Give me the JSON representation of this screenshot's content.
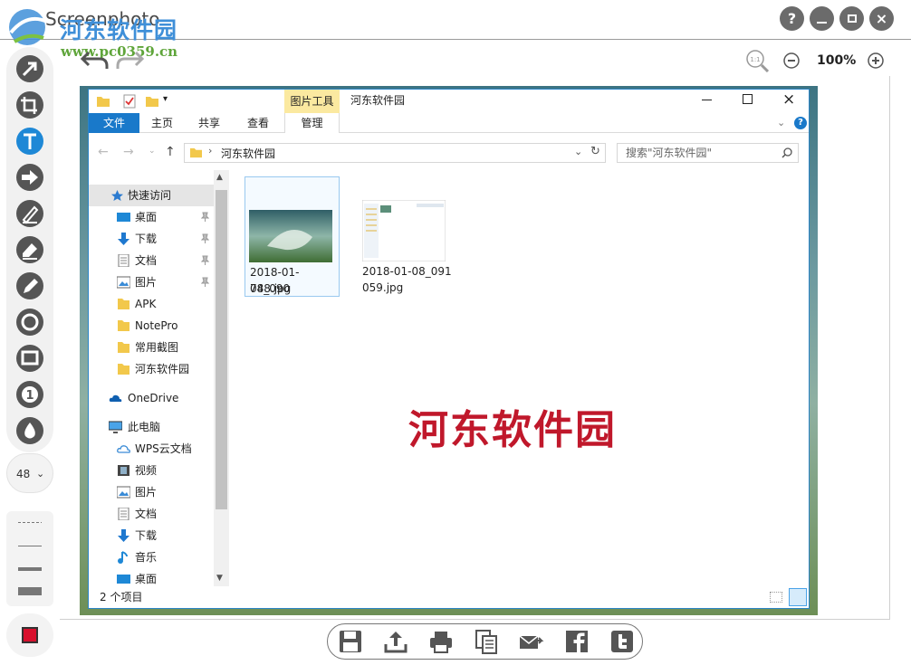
{
  "app": {
    "title": "Screenphoto"
  },
  "watermark": {
    "brand": "河东软件园",
    "url": "www.pc0359.cn"
  },
  "window_controls": {
    "help": "?",
    "minimize": "–",
    "maximize": "▫",
    "close": "×"
  },
  "toolbar_left": {
    "tools": [
      "arrow-icon",
      "crop-icon",
      "text-icon",
      "arrow-right-icon",
      "marker-icon",
      "eraser-icon",
      "pencil-icon",
      "circle-icon",
      "rectangle-icon",
      "number-icon",
      "blur-icon"
    ],
    "size_value": "48",
    "line_styles": [
      "dashed",
      "thin",
      "medium",
      "thick"
    ],
    "color": "#d8102d"
  },
  "zoom": {
    "level": "100%"
  },
  "explorer": {
    "ribbon_context": "图片工具",
    "window_title": "河东软件园",
    "tabs": [
      "文件",
      "主页",
      "共享",
      "查看",
      "管理"
    ],
    "address": "河东软件园",
    "search_placeholder": "搜索\"河东软件园\"",
    "nav": {
      "quick_access": "快速访问",
      "pinned": [
        "桌面",
        "下载",
        "文档",
        "图片"
      ],
      "folders": [
        "APK",
        "NotePro",
        "常用截图",
        "河东软件园"
      ],
      "onedrive": "OneDrive",
      "this_pc": "此电脑",
      "pc_items": [
        "WPS云文档",
        "视频",
        "图片",
        "文档",
        "下载",
        "音乐",
        "桌面"
      ]
    },
    "files": [
      {
        "name_line1": "2018-01-08_090",
        "name_line2": "748.jpg"
      },
      {
        "name_line1": "2018-01-08_091",
        "name_line2": "059.jpg"
      }
    ],
    "status": "2 个项目",
    "overlay_text": "河东软件园"
  },
  "bottom_actions": [
    "save-icon",
    "upload-icon",
    "print-icon",
    "copy-icon",
    "email-icon",
    "facebook-icon",
    "twitter-icon"
  ]
}
